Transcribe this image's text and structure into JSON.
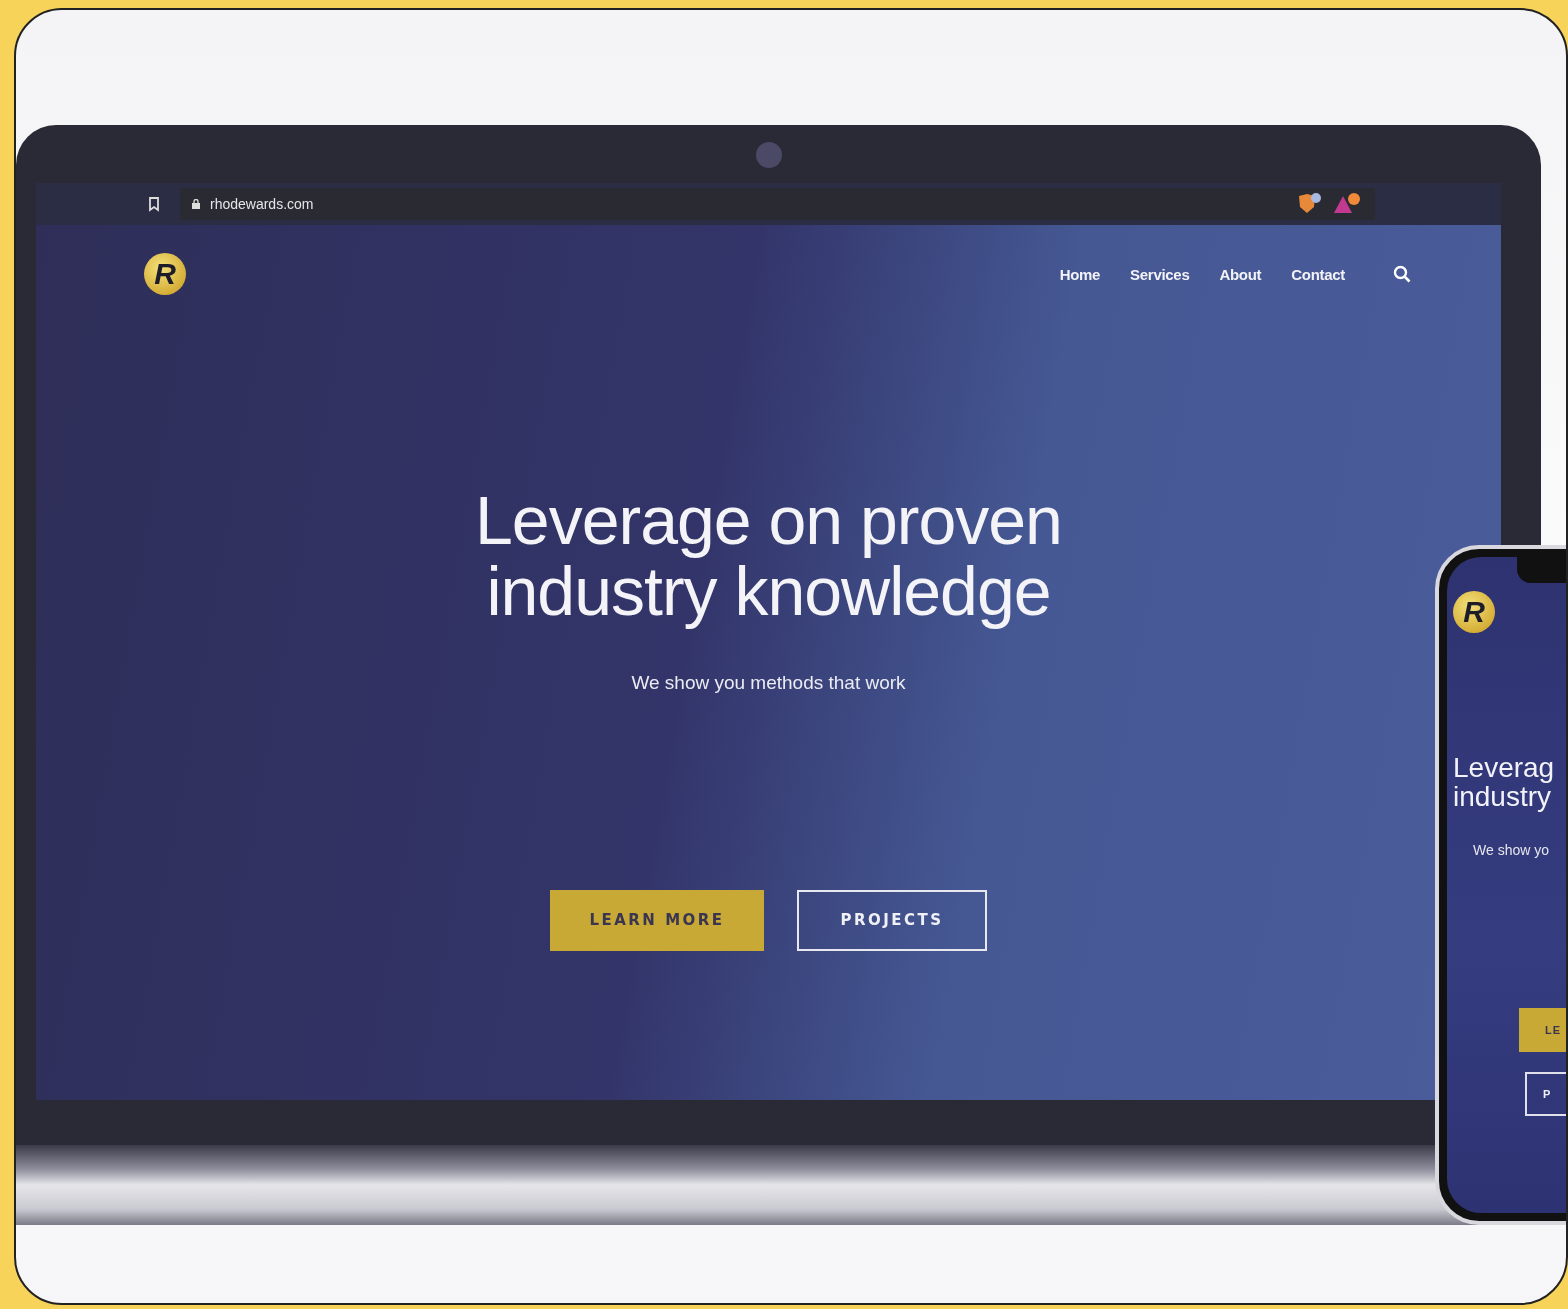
{
  "browser": {
    "url": "rhodewards.com"
  },
  "site": {
    "logo_letter": "R",
    "nav": [
      {
        "label": "Home"
      },
      {
        "label": "Services"
      },
      {
        "label": "About"
      },
      {
        "label": "Contact"
      }
    ],
    "headline": [
      "Leverage on proven",
      "industry knowledge"
    ],
    "subtitle": "We show you methods that work",
    "buttons": [
      {
        "label": "LEARN MORE",
        "kind": "primary"
      },
      {
        "label": "PROJECTS",
        "kind": "outline"
      }
    ]
  },
  "phone": {
    "logo_letter": "R",
    "headline": [
      "Leverag",
      "industry"
    ],
    "subtitle": "We show yo",
    "buttons": [
      {
        "label": "LE",
        "kind": "primary"
      },
      {
        "label": "P",
        "kind": "outline"
      }
    ]
  }
}
